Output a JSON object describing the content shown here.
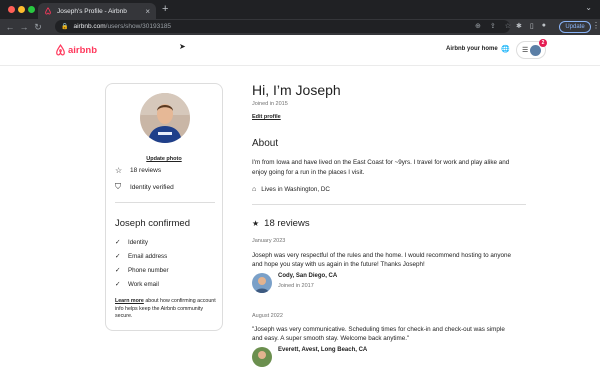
{
  "browser": {
    "tab_title": "Joseph's Profile - Airbnb",
    "url_host": "airbnb.com",
    "url_path": "/users/show/30193185",
    "update_label": "Update"
  },
  "header": {
    "logo_text": "airbnb",
    "host_link": "Airbnb your home",
    "notification_count": "2"
  },
  "sidebar": {
    "update_photo": "Update photo",
    "reviews_count": "18 reviews",
    "identity": "Identity verified",
    "confirmed_title": "Joseph confirmed",
    "confirmed_items": [
      "Identity",
      "Email address",
      "Phone number",
      "Work email"
    ],
    "learn_more": "Learn more",
    "learn_rest": " about how confirming account info helps keep the Airbnb community secure."
  },
  "profile": {
    "greeting": "Hi, I’m Joseph",
    "joined": "Joined in 2015",
    "edit_profile": "Edit profile",
    "about_title": "About",
    "bio": "I'm from Iowa and have lived on the East Coast for ~9yrs. I travel for work and play alike and enjoy going for a run in the places I visit.",
    "lives_in": "Lives in Washington, DC",
    "reviews_title": "18 reviews"
  },
  "reviews": [
    {
      "date": "January 2023",
      "text": "Joseph was very respectful of the rules and the home. I would recommend hosting to anyone and hope you stay with us again in the future! Thanks Joseph!",
      "name": "Cody, San Diego, CA",
      "joined": "Joined in 2017"
    },
    {
      "date": "August 2022",
      "text": "\"Joseph was very communicative. Scheduling times for check-in and check-out was simple and easy. A super smooth stay. Welcome back anytime.\"",
      "name": "Everett, Avest, Long Beach, CA",
      "joined": ""
    }
  ],
  "colors": {
    "brand": "#ff385c",
    "text": "#222222",
    "muted": "#717171"
  }
}
